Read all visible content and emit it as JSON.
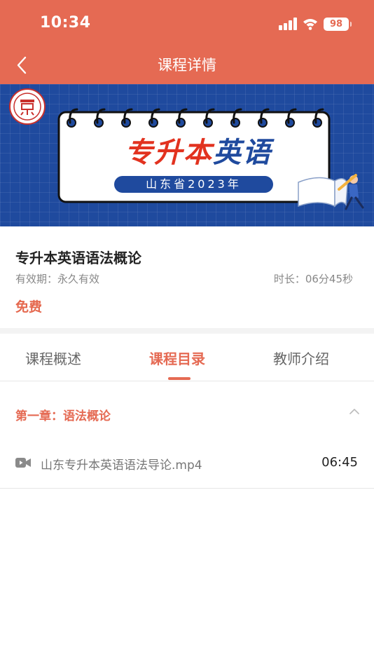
{
  "status_bar": {
    "time": "10:34",
    "battery": "98"
  },
  "nav": {
    "title": "课程详情"
  },
  "banner": {
    "title_part1": "专升本",
    "title_part2": "英语",
    "subtitle": "山东省2023年"
  },
  "course": {
    "title": "专升本英语语法概论",
    "validity": "有效期：永久有效",
    "duration": "时长：06分45秒",
    "price": "免费"
  },
  "tabs": [
    {
      "label": "课程概述",
      "active": false
    },
    {
      "label": "课程目录",
      "active": true
    },
    {
      "label": "教师介绍",
      "active": false
    }
  ],
  "catalog": {
    "chapters": [
      {
        "title": "第一章：语法概论",
        "expanded": true,
        "lessons": [
          {
            "name": "山东专升本英语语法导论.mp4",
            "time": "06:45",
            "icon": "video-icon"
          }
        ]
      }
    ]
  },
  "colors": {
    "accent": "#e56a53",
    "banner_blue": "#1f4a9e",
    "banner_red": "#e2321f"
  }
}
